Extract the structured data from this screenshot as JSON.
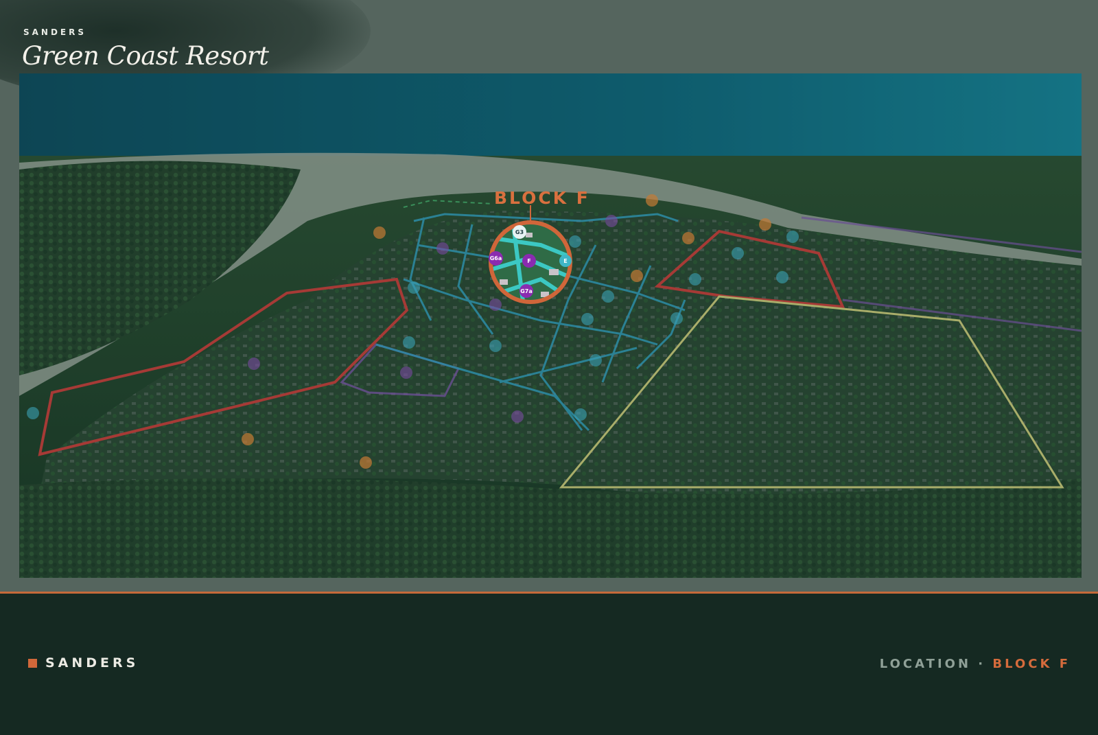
{
  "header": {
    "brand": "SANDERS",
    "title": "Green Coast Resort"
  },
  "map": {
    "highlight_label": "BLOCK F",
    "lot_markers": [
      "G3",
      "G6a",
      "F",
      "E",
      "G7a"
    ],
    "colors": {
      "sea": "#0f6f86",
      "beach": "#a8b5a8",
      "forest": "#24452f",
      "highlight_ring": "#d0663a",
      "red_zone": "#a63a36",
      "teal_zone": "#2d8ca6",
      "yellow_zone": "#a9ad6a",
      "purple_zone": "#6a4f93",
      "marker_purple": "#8a2bb0",
      "marker_teal": "#3fb6c6"
    }
  },
  "footer": {
    "brand": "SANDERS",
    "location_label": "LOCATION",
    "separator": "·",
    "location_value": "BLOCK F",
    "accent_color": "#d56b3c"
  }
}
